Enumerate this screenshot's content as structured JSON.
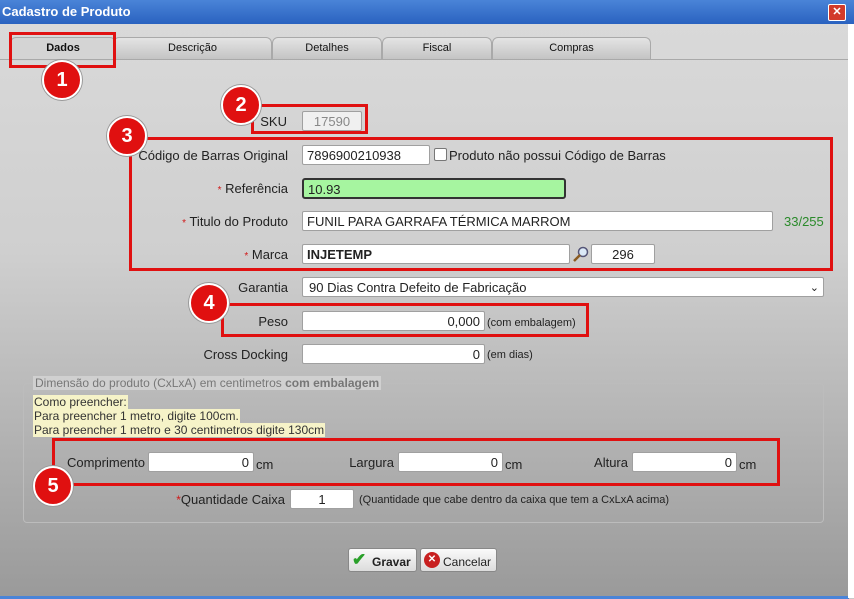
{
  "window": {
    "title": "Cadastro de Produto",
    "close_icon": "close-icon"
  },
  "tabs": [
    {
      "label": "Dados",
      "active": true
    },
    {
      "label": "Descrição",
      "active": false
    },
    {
      "label": "Detalhes",
      "active": false
    },
    {
      "label": "Fiscal",
      "active": false
    },
    {
      "label": "Compras",
      "active": false
    }
  ],
  "annotations": [
    "1",
    "2",
    "3",
    "4",
    "5"
  ],
  "form": {
    "sku": {
      "label": "SKU",
      "value": "17590"
    },
    "barcode": {
      "label": "Código de Barras Original",
      "value": "7896900210938",
      "no_barcode_label": "Produto não possui Código de Barras",
      "no_barcode_checked": false
    },
    "reference": {
      "required_mark": "*",
      "label": "Referência",
      "value": "10.93"
    },
    "product_title": {
      "required_mark": "*",
      "label": "Titulo do Produto",
      "value": "FUNIL PARA GARRAFA TÉRMICA MARROM",
      "counter": "33/255"
    },
    "brand": {
      "required_mark": "*",
      "label": "Marca",
      "value": "INJETEMP",
      "search_icon": "magnifier-icon",
      "brand_id": "296"
    },
    "warranty": {
      "label": "Garantia",
      "value": "90 Dias Contra Defeito de Fabricação"
    },
    "weight": {
      "label": "Peso",
      "value": "0,000",
      "hint": "(com embalagem)"
    },
    "cross_docking": {
      "label": "Cross Docking",
      "value": "0",
      "hint": "(em dias)"
    }
  },
  "dimensions": {
    "legend_prefix": "Dimensão do produto (CxLxA) em centimetros",
    "legend_bold": "com embalagem",
    "howto": [
      "Como preencher:",
      "Para preencher 1 metro, digite 100cm.",
      "Para preencher 1 metro e 30 centimetros digite 130cm"
    ],
    "length": {
      "label": "Comprimento",
      "value": "0",
      "unit": "cm"
    },
    "width": {
      "label": "Largura",
      "value": "0",
      "unit": "cm"
    },
    "height": {
      "label": "Altura",
      "value": "0",
      "unit": "cm"
    },
    "box_quantity": {
      "required_mark": "*",
      "label": "Quantidade Caixa",
      "value": "1",
      "hint": "(Quantidade que cabe dentro da caixa que tem a CxLxA acima)"
    }
  },
  "buttons": {
    "save": "Gravar",
    "cancel": "Cancelar"
  },
  "colors": {
    "reference_highlight": "#a6f5a0",
    "annotation_red": "#e01010",
    "counter_green": "#2a8a2a"
  }
}
